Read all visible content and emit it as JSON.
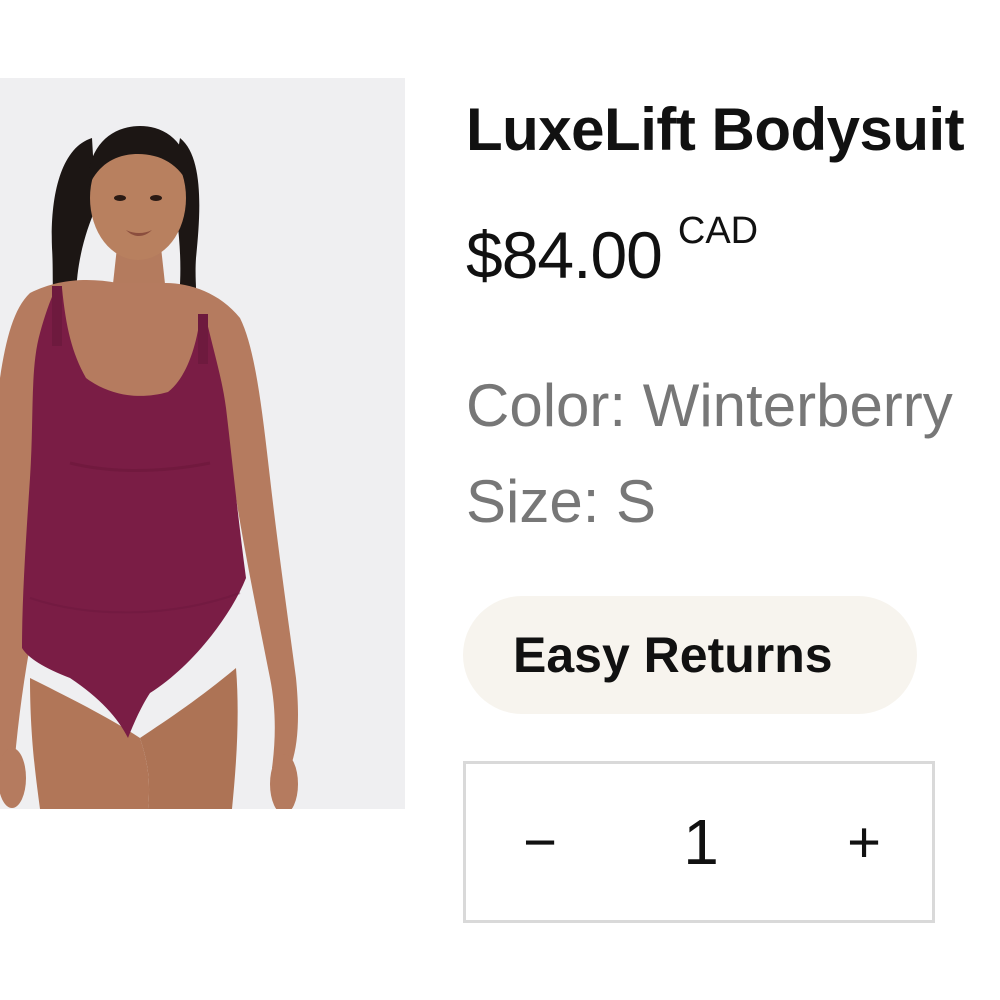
{
  "product": {
    "title": "LuxeLift Bodysuit",
    "price": "$84.00",
    "currency": "CAD",
    "color_line": "Color: Winterberry",
    "size_line": "Size: S",
    "image_alt": "Model wearing LuxeLift Bodysuit in Winterberry"
  },
  "badges": {
    "easy_returns": "Easy Returns"
  },
  "quantity": {
    "decrement_label": "−",
    "value": "1",
    "increment_label": "+"
  },
  "colors": {
    "garment": "#7a1d45",
    "pill_background": "#f7f4ee",
    "meta_text": "#777777",
    "stepper_border": "#d9d9d9"
  }
}
